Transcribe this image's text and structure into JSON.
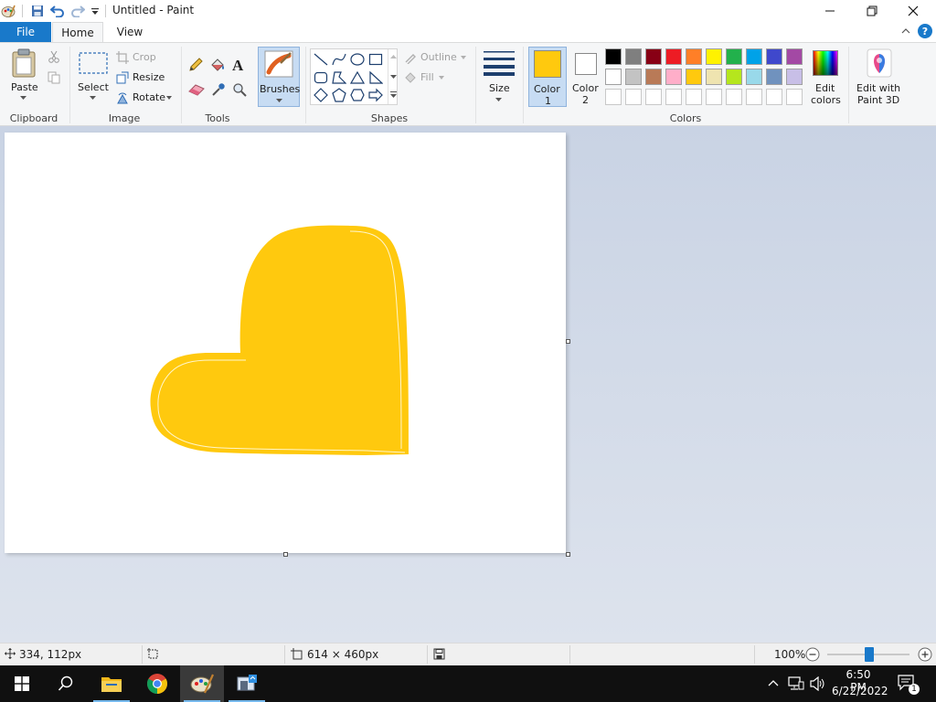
{
  "window": {
    "title": "Untitled - Paint"
  },
  "tabs": {
    "file": "File",
    "home": "Home",
    "view": "View"
  },
  "ribbon": {
    "clipboard": {
      "paste": "Paste",
      "group": "Clipboard"
    },
    "image": {
      "select": "Select",
      "crop": "Crop",
      "resize": "Resize",
      "rotate": "Rotate",
      "group": "Image"
    },
    "tools": {
      "group": "Tools"
    },
    "brushes": {
      "label": "Brushes"
    },
    "shapes": {
      "outline": "Outline",
      "fill": "Fill",
      "group": "Shapes"
    },
    "size": {
      "label": "Size"
    },
    "colors": {
      "color1_label": "Color",
      "color1_num": "1",
      "color2_label": "Color",
      "color2_num": "2",
      "color1_value": "#ffc90e",
      "color2_value": "#ffffff",
      "edit_colors_line1": "Edit",
      "edit_colors_line2": "colors",
      "paint3d_line1": "Edit with",
      "paint3d_line2": "Paint 3D",
      "group": "Colors",
      "palette_row1": [
        "#000000",
        "#7f7f7f",
        "#880015",
        "#ed1c24",
        "#ff7f27",
        "#fff200",
        "#22b14c",
        "#00a2e8",
        "#3f48cc",
        "#a349a4"
      ],
      "palette_row2": [
        "#ffffff",
        "#c3c3c3",
        "#b97a57",
        "#ffaec9",
        "#ffc90e",
        "#efe4b0",
        "#b5e61d",
        "#99d9ea",
        "#7092be",
        "#c8bfe7"
      ]
    }
  },
  "canvas": {
    "shape_color": "#ffc90e"
  },
  "status": {
    "cursor_pos": "334, 112px",
    "canvas_size": "614 × 460px",
    "zoom": "100%"
  },
  "taskbar": {
    "time": "6:50 PM",
    "date": "6/22/2022",
    "notification_count": "1"
  }
}
